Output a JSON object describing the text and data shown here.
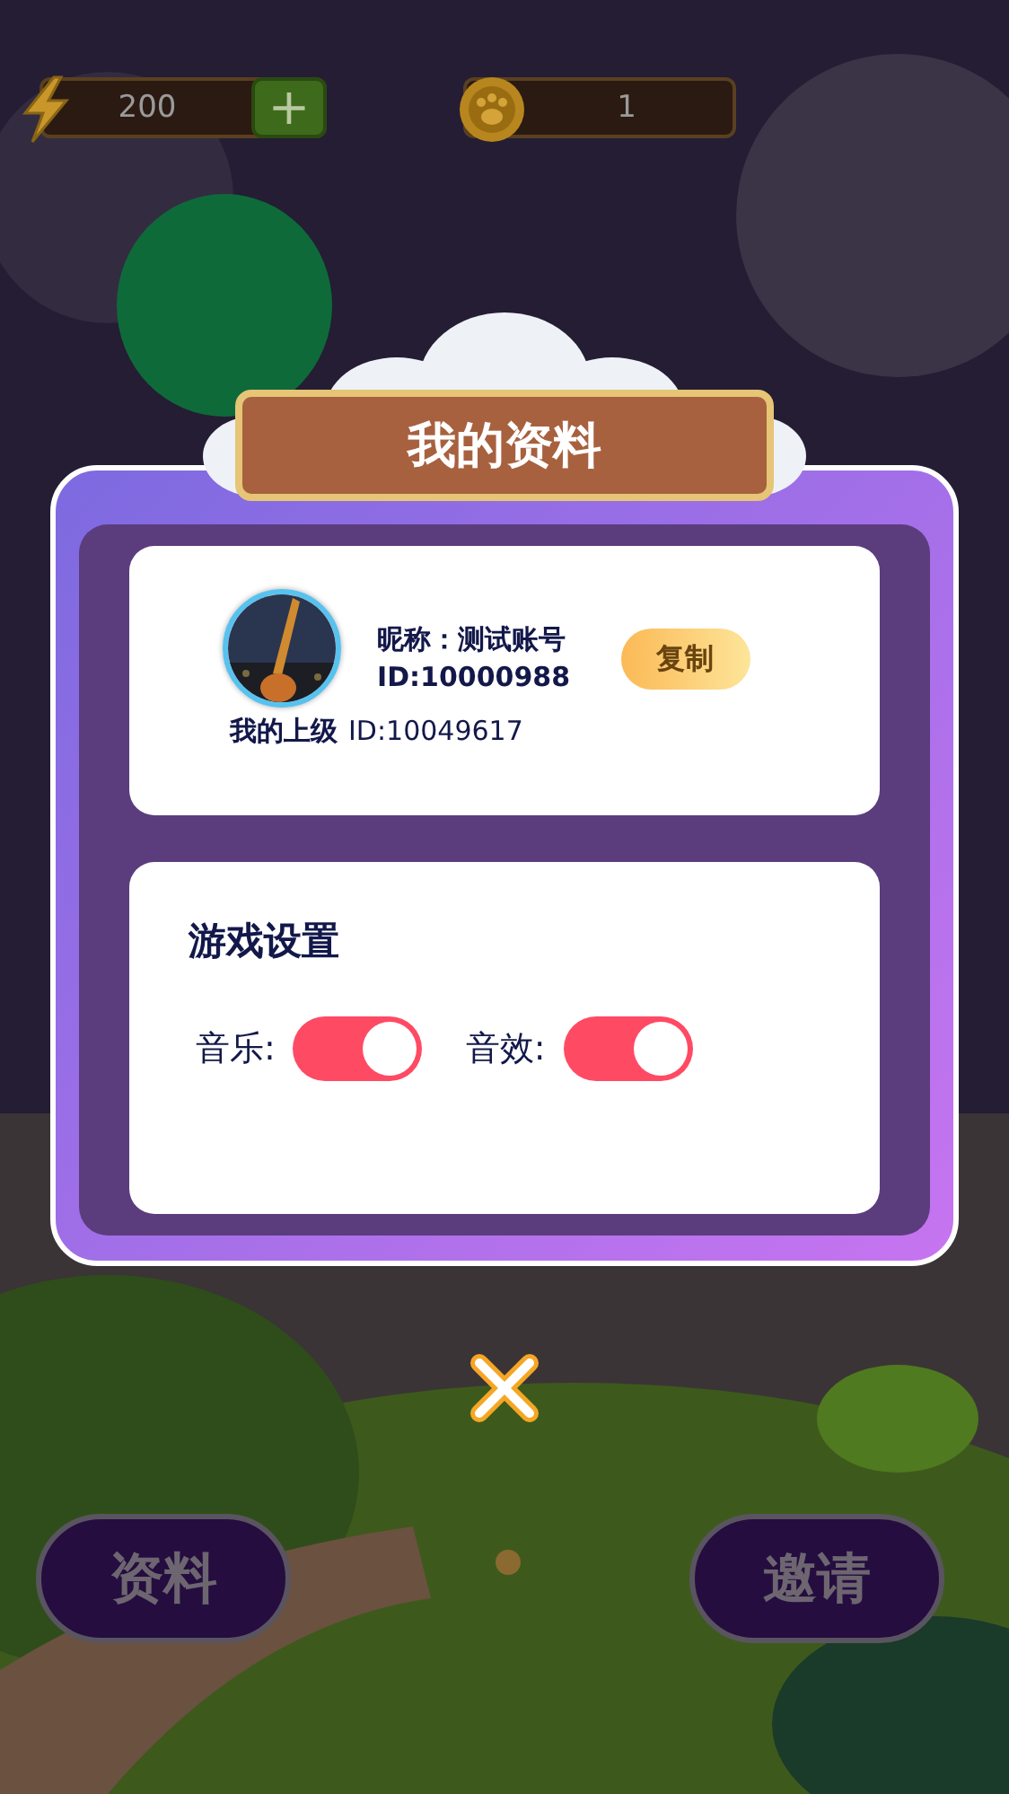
{
  "top_bar": {
    "energy": "200",
    "add_button": "+",
    "coins": "1"
  },
  "dialog": {
    "title": "我的资料",
    "profile": {
      "nickname": "昵称：测试账号",
      "id": "ID:10000988",
      "copy_button": "复制",
      "superior_label": "我的上级",
      "superior_id": "ID:10049617"
    },
    "settings": {
      "title": "游戏设置",
      "toggles": [
        {
          "label": "音乐:",
          "on": true
        },
        {
          "label": "音效:",
          "on": true
        }
      ]
    }
  },
  "bottom_buttons": [
    "资料",
    "邀请"
  ]
}
